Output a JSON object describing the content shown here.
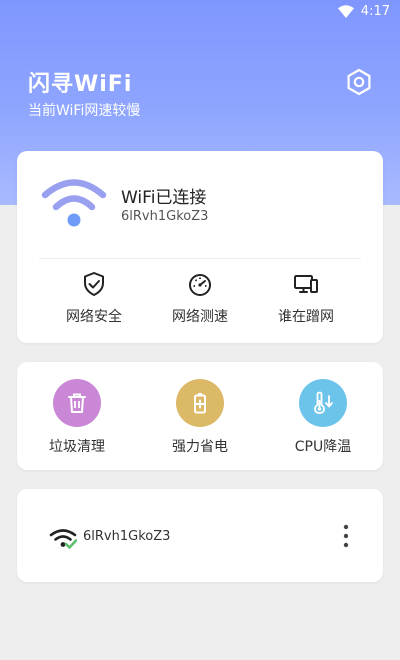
{
  "status_bar": {
    "time": "4:17",
    "wifi_icon": "wifi-signal-icon"
  },
  "header": {
    "title": "闪寻WiFi",
    "subtitle": "当前WiFi网速较慢",
    "settings_icon": "hexagon-gear-icon",
    "gradient": [
      "#7f96ff",
      "#a9baff"
    ]
  },
  "connection": {
    "status": "WiFi已连接",
    "ssid": "6lRvh1GkoZ3",
    "wifi_color": "#9aa0f0",
    "wifi_dot_color": "#6f9bf7",
    "actions": [
      {
        "label": "网络安全",
        "icon": "shield-check-icon"
      },
      {
        "label": "网络测速",
        "icon": "speedometer-icon"
      },
      {
        "label": "谁在蹭网",
        "icon": "devices-icon"
      }
    ]
  },
  "tools": [
    {
      "label": "垃圾清理",
      "icon": "trash-icon",
      "color": "#c987d6"
    },
    {
      "label": "强力省电",
      "icon": "battery-icon",
      "color": "#dcb966"
    },
    {
      "label": "CPU降温",
      "icon": "thermometer-icon",
      "color": "#6cc4ea"
    }
  ],
  "network_list": [
    {
      "ssid": "6lRvh1GkoZ3",
      "icon": "wifi-connected-icon",
      "check_color": "#5cbf6a"
    }
  ]
}
